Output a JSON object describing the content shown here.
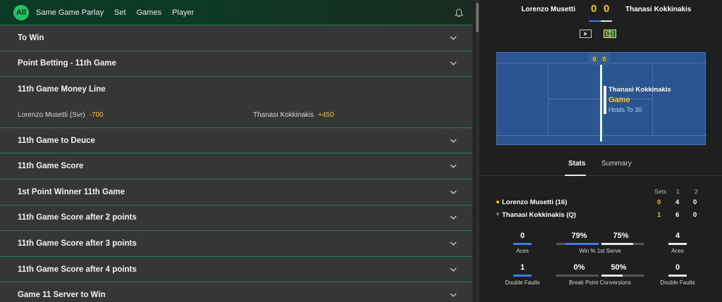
{
  "nav": {
    "all_label": "All",
    "items": [
      "Same Game Parlay",
      "Set",
      "Games",
      "Player"
    ]
  },
  "markets": [
    {
      "title": "To Win"
    },
    {
      "title": "Point Betting - 11th Game"
    },
    {
      "title": "11th Game Money Line"
    },
    {
      "title": "11th Game to Deuce"
    },
    {
      "title": "11th Game Score"
    },
    {
      "title": "1st Point Winner 11th Game"
    },
    {
      "title": "11th Game Score after 2 points"
    },
    {
      "title": "11th Game Score after 3 points"
    },
    {
      "title": "11th Game Score after 4 points"
    },
    {
      "title": "Game 11 Server to Win"
    }
  ],
  "money_line": {
    "sel1": {
      "name": "Lorenzo Musetti (Svr)",
      "odds": "-700"
    },
    "sel2": {
      "name": "Thanasi Kokkinakis",
      "odds": "+450"
    }
  },
  "scoreboard": {
    "player1": "Lorenzo Musetti",
    "player2": "Thanasi Kokkinakis",
    "score1": "0",
    "score2": "0"
  },
  "court": {
    "point1": "0",
    "point2": "0",
    "player": "Thanasi Kokkinakis",
    "event": "Game",
    "detail": "Holds To 30"
  },
  "tabs": {
    "stats": "Stats",
    "summary": "Summary"
  },
  "sets_table": {
    "headers": [
      "Sets",
      "1",
      "2"
    ],
    "rows": [
      {
        "name": "Lorenzo Musetti (16)",
        "sets": "0",
        "s1": "4",
        "s2": "0"
      },
      {
        "name": "Thanasi Kokkinakis (Q)",
        "sets": "1",
        "s1": "6",
        "s2": "0"
      }
    ]
  },
  "stats": {
    "aces": {
      "p1": "0",
      "p2": "4",
      "label": "Aces"
    },
    "first_serve": {
      "p1": "79%",
      "p2": "75%",
      "label": "Win % 1st Serve",
      "p1_fraction": 0.79,
      "p2_fraction": 0.75
    },
    "double_faults": {
      "p1": "1",
      "p2": "0",
      "label": "Double Faults"
    },
    "break_points": {
      "p1": "0%",
      "p2": "50%",
      "label": "Break Point Conversions",
      "p1_fraction": 0.0,
      "p2_fraction": 0.5
    }
  },
  "colors": {
    "accent_green": "#23c26a",
    "divider_green": "#2a7e56",
    "odds_yellow": "#f5c518",
    "court_blue": "#2a5590",
    "p1_blue": "#3f7fe0",
    "p2_white": "#e8e8e8"
  }
}
